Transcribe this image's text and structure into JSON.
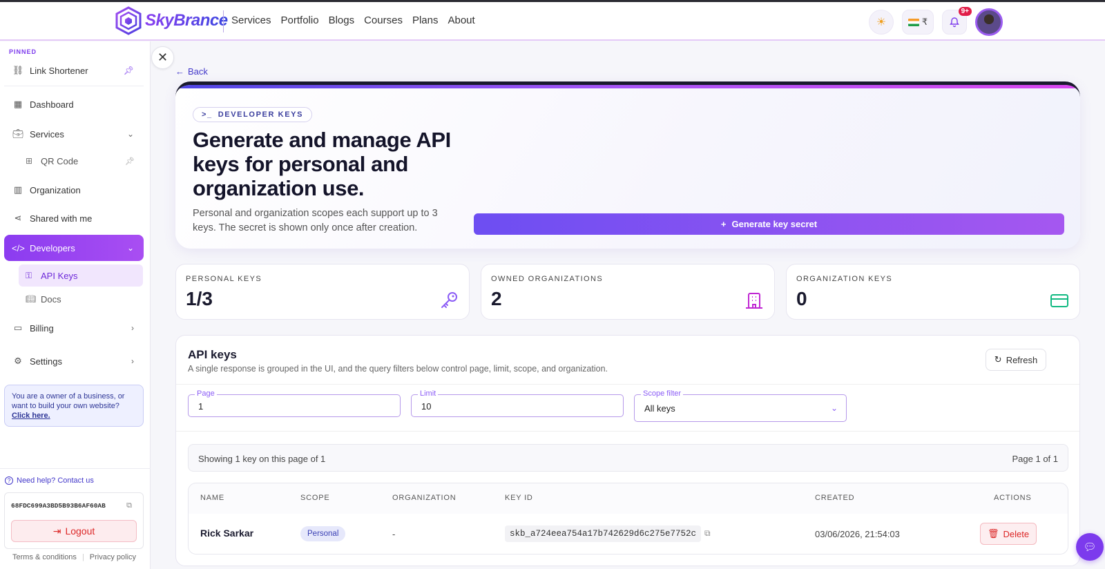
{
  "brand": {
    "name": "SkyBrance"
  },
  "nav": [
    "Services",
    "Portfolio",
    "Blogs",
    "Courses",
    "Plans",
    "About"
  ],
  "header": {
    "currency": "₹",
    "notifications_badge": "9+"
  },
  "sidebar": {
    "pinned_label": "PINNED",
    "items": [
      {
        "label": "Link Shortener",
        "icon": "link-icon"
      },
      {
        "label": "Dashboard",
        "icon": "dashboard-icon"
      },
      {
        "label": "Services",
        "icon": "briefcase-icon"
      },
      {
        "label": "QR Code",
        "icon": "qr-code-icon"
      },
      {
        "label": "Organization",
        "icon": "building-icon"
      },
      {
        "label": "Shared with me",
        "icon": "share-icon"
      },
      {
        "label": "Developers",
        "icon": "code-icon"
      },
      {
        "label": "API Keys",
        "icon": "key-icon"
      },
      {
        "label": "Docs",
        "icon": "book-icon"
      },
      {
        "label": "Billing",
        "icon": "credit-card-icon"
      },
      {
        "label": "Settings",
        "icon": "gear-icon"
      }
    ],
    "promo_text": "You are a owner of a business, or want to build your own website?",
    "promo_link": "Click here.",
    "help_text": "Need help? Contact us",
    "user_id": "68FDC699A3BD5B93B6AF60AB",
    "logout_label": "Logout",
    "terms_label": "Terms & conditions",
    "privacy_label": "Privacy policy"
  },
  "main": {
    "back_label": "Back",
    "hero": {
      "chip": "DEVELOPER KEYS",
      "title": "Generate and manage API keys for personal and organization use.",
      "description": "Personal and organization scopes each support up to 3 keys. The secret is shown only once after creation.",
      "generate_button": "Generate key secret"
    },
    "stats": [
      {
        "label": "PERSONAL KEYS",
        "value": "1/3",
        "icon": "key-icon"
      },
      {
        "label": "OWNED ORGANIZATIONS",
        "value": "2",
        "icon": "building-icon"
      },
      {
        "label": "ORGANIZATION KEYS",
        "value": "0",
        "icon": "credit-card-icon"
      }
    ],
    "panel": {
      "title": "API keys",
      "subtitle": "A single response is grouped in the UI, and the query filters below control page, limit, scope, and organization.",
      "refresh_label": "Refresh",
      "filters": {
        "page": {
          "label": "Page",
          "value": "1"
        },
        "limit": {
          "label": "Limit",
          "value": "10"
        },
        "scope": {
          "label": "Scope filter",
          "value": "All keys"
        }
      },
      "summary_left": "Showing 1 key on this page of 1",
      "summary_right": "Page 1 of 1",
      "columns": [
        "NAME",
        "SCOPE",
        "ORGANIZATION",
        "KEY ID",
        "CREATED",
        "ACTIONS"
      ],
      "rows": [
        {
          "name": "Rick Sarkar",
          "scope": "Personal",
          "organization": "-",
          "key_id": "skb_a724eea754a17b742629d6c275e7752c",
          "created": "03/06/2026, 21:54:03",
          "action": "Delete"
        }
      ]
    }
  }
}
